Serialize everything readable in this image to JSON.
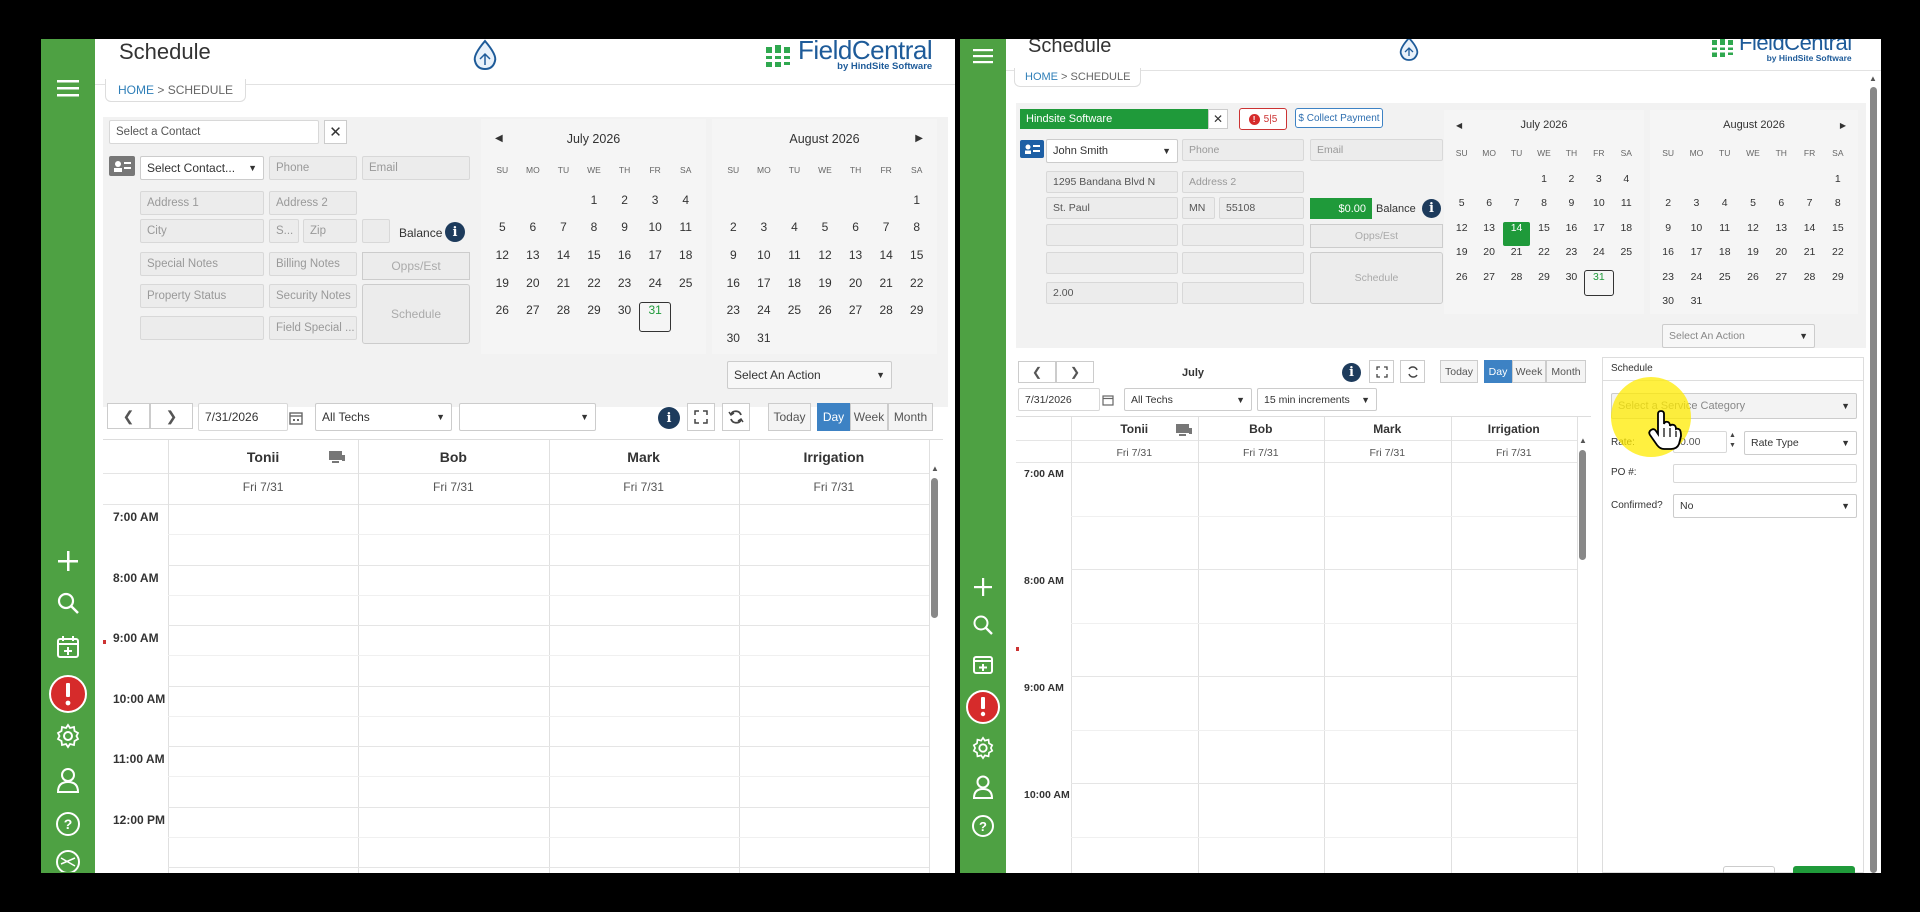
{
  "colors": {
    "accent_green": "#4ea143",
    "brand_blue": "#1e5b99",
    "active_blue": "#3d82c4",
    "today_green": "#1f9a3a",
    "alert_red": "#d62b2b"
  },
  "left": {
    "title": "Schedule",
    "breadcrumb": {
      "home": "HOME",
      "sep": " > ",
      "current": "SCHEDULE"
    },
    "logo": {
      "name": "FieldCentral",
      "sub": "by HindSite Software"
    },
    "contact": {
      "placeholder": "Select a Contact",
      "select_label": "Select Contact...",
      "phone": "Phone",
      "email": "Email",
      "address1": "Address 1",
      "address2": "Address 2",
      "city": "City",
      "state": "S...",
      "zip": "Zip",
      "balance": "Balance",
      "special_notes": "Special Notes",
      "billing_notes": "Billing Notes",
      "opps_est": "Opps/Est",
      "property_status": "Property Status",
      "security_notes": "Security Notes",
      "schedule_btn": "Schedule",
      "field_special": "Field Special ..."
    },
    "action": "Select An Action",
    "toolbar": {
      "date": "7/31/2026",
      "techs": "All Techs",
      "today": "Today",
      "day": "Day",
      "week": "Week",
      "month": "Month"
    },
    "columns": [
      {
        "name": "Tonii",
        "date": "Fri 7/31"
      },
      {
        "name": "Bob",
        "date": "Fri 7/31"
      },
      {
        "name": "Mark",
        "date": "Fri 7/31"
      },
      {
        "name": "Irrigation",
        "date": "Fri 7/31"
      }
    ],
    "times": [
      "7:00 AM",
      "8:00 AM",
      "9:00 AM",
      "10:00 AM",
      "11:00 AM",
      "12:00 PM"
    ]
  },
  "right": {
    "title": "Schedule",
    "breadcrumb": {
      "home": "HOME",
      "sep": " > ",
      "current": "SCHEDULE"
    },
    "logo": {
      "name": "FieldCentral",
      "sub": "by HindSite Software"
    },
    "contact": {
      "company": "Hindsite Software",
      "alert": "5|5",
      "collect": "$ Collect Payment",
      "name": "John Smith",
      "phone": "Phone",
      "email": "Email",
      "address1": "1295 Bandana Blvd N",
      "address2": "Address 2",
      "city": "St. Paul",
      "state": "MN",
      "zip": "55108",
      "balance_amt": "$0.00",
      "balance": "Balance",
      "opps_est": "Opps/Est",
      "schedule_btn": "Schedule",
      "value": "2.00"
    },
    "action": "Select An Action",
    "toolbar": {
      "date": "7/31/2026",
      "techs": "All Techs",
      "increments": "15 min increments",
      "today": "Today",
      "day": "Day",
      "week": "Week",
      "month": "Month",
      "month_label": "July"
    },
    "columns": [
      {
        "name": "Tonii",
        "date": "Fri 7/31"
      },
      {
        "name": "Bob",
        "date": "Fri 7/31"
      },
      {
        "name": "Mark",
        "date": "Fri 7/31"
      },
      {
        "name": "Irrigation",
        "date": "Fri 7/31"
      }
    ],
    "times": [
      "7:00 AM",
      "8:00 AM",
      "9:00 AM",
      "10:00 AM"
    ],
    "panel": {
      "tab": "Schedule",
      "service_category": "Select a Service Category",
      "rate_label": "Rate:",
      "rate_value": "0.00",
      "rate_type": "Rate Type",
      "po_label": "PO #:",
      "confirmed_label": "Confirmed?",
      "confirmed_value": "No"
    }
  },
  "cal": {
    "dow": [
      "SU",
      "MO",
      "TU",
      "WE",
      "TH",
      "FR",
      "SA"
    ],
    "july": {
      "title": "July 2026",
      "days": [
        "",
        "",
        "",
        "1",
        "2",
        "3",
        "4",
        "5",
        "6",
        "7",
        "8",
        "9",
        "10",
        "11",
        "12",
        "13",
        "14",
        "15",
        "16",
        "17",
        "18",
        "19",
        "20",
        "21",
        "22",
        "23",
        "24",
        "25",
        "26",
        "27",
        "28",
        "29",
        "30",
        "31",
        ""
      ]
    },
    "august": {
      "title": "August 2026",
      "days": [
        "",
        "",
        "",
        "",
        "",
        "",
        "1",
        "2",
        "3",
        "4",
        "5",
        "6",
        "7",
        "8",
        "9",
        "10",
        "11",
        "12",
        "13",
        "14",
        "15",
        "16",
        "17",
        "18",
        "19",
        "20",
        "21",
        "22",
        "23",
        "24",
        "25",
        "26",
        "27",
        "28",
        "29",
        "30",
        "31"
      ]
    }
  }
}
